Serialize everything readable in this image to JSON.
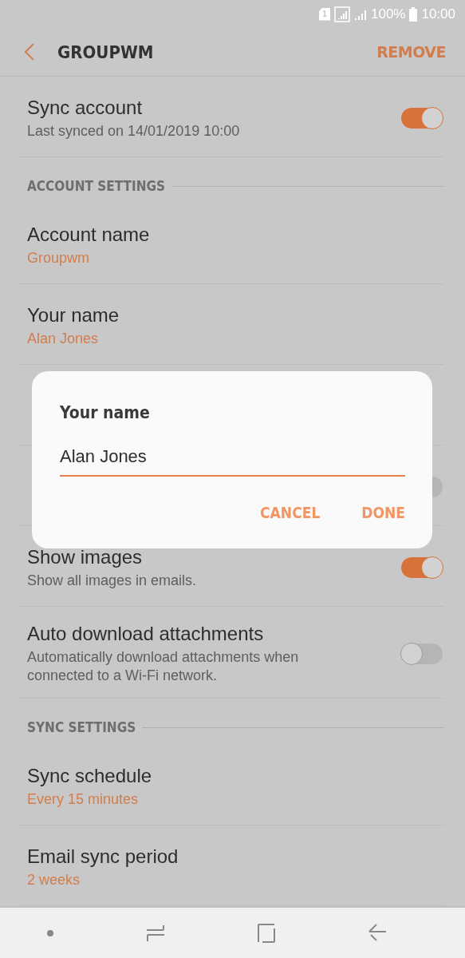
{
  "status_bar": {
    "sim_slot": "1",
    "battery": "100%",
    "time": "10:00"
  },
  "app_bar": {
    "title": "GROUPWM",
    "action": "REMOVE"
  },
  "items": [
    {
      "kind": "setting",
      "title": "Sync account",
      "description": "Last synced on 14/01/2019  10:00",
      "on": true
    },
    {
      "kind": "header",
      "title": "ACCOUNT SETTINGS"
    },
    {
      "kind": "setting",
      "title": "Account name",
      "value": "Groupwm"
    },
    {
      "kind": "setting",
      "title": "Your name",
      "value": "Alan Jones"
    },
    {
      "kind": "setting"
    },
    {
      "kind": "setting",
      "on": false
    },
    {
      "kind": "setting",
      "title": "Show images",
      "description": "Show all images in emails.",
      "on": true
    },
    {
      "kind": "setting",
      "title": "Auto download attachments",
      "description": "Automatically download attachments when connected to a Wi-Fi network.",
      "on": false
    },
    {
      "kind": "header",
      "title": "SYNC SETTINGS"
    },
    {
      "kind": "setting",
      "title": "Sync schedule",
      "value": "Every 15 minutes"
    },
    {
      "kind": "setting",
      "title": "Email sync period",
      "value": "2 weeks"
    }
  ],
  "dialog": {
    "title": "Your name",
    "value": "Alan Jones",
    "buttons": [
      "CANCEL",
      "DONE"
    ]
  }
}
